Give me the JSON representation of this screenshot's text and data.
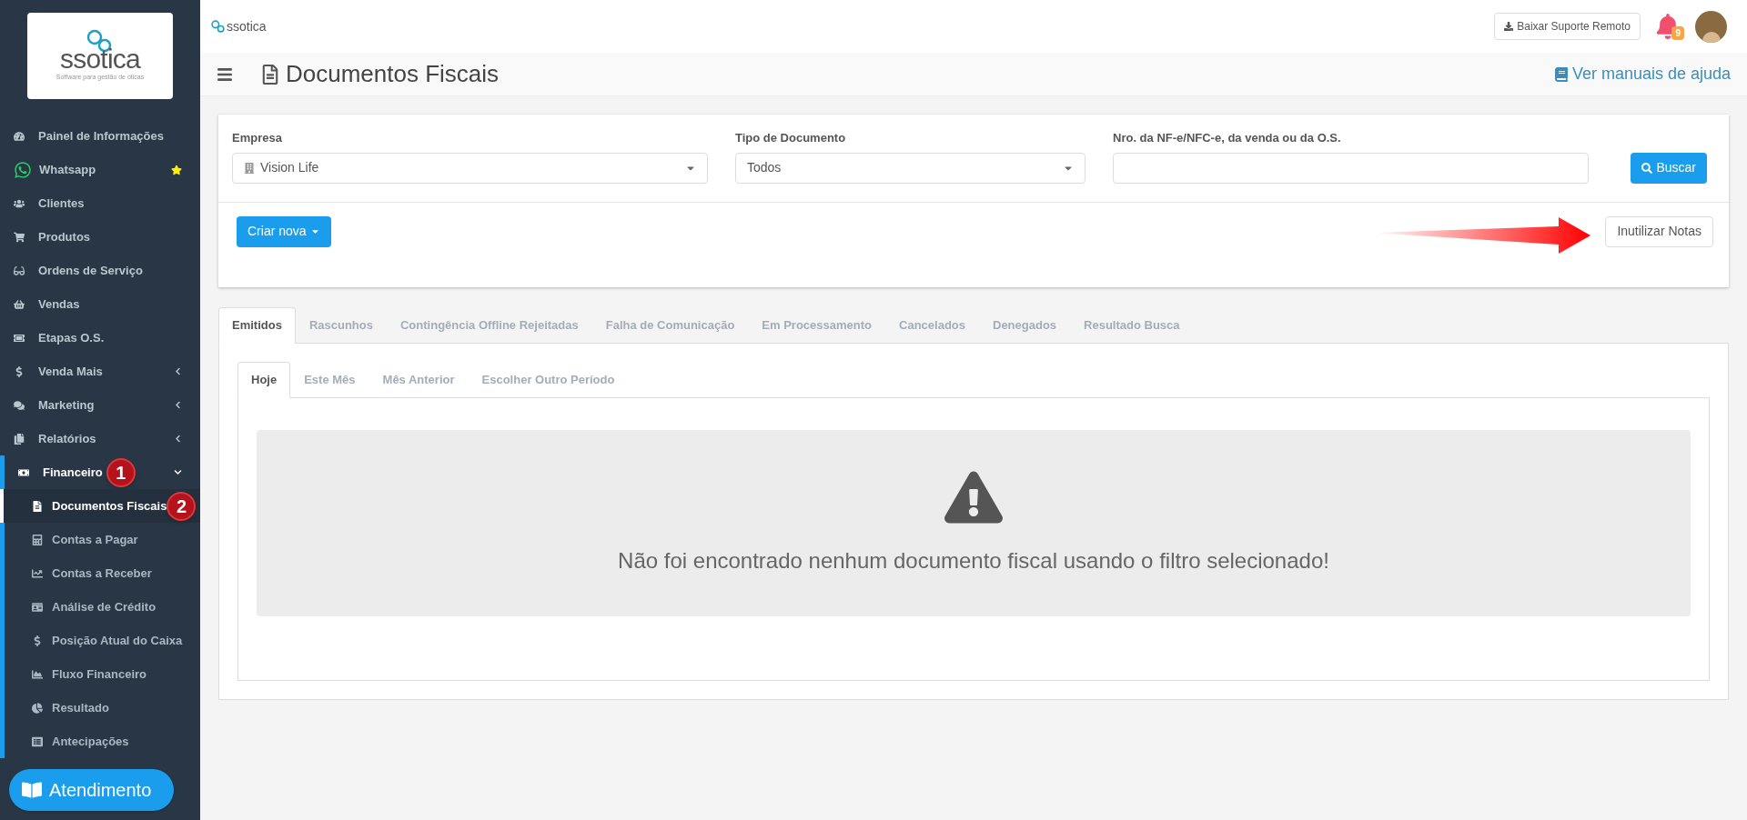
{
  "logo": {
    "name": "ssotica",
    "tagline": "Software para gestão de óticas"
  },
  "sidebar": {
    "items": [
      {
        "kind": "item",
        "label": "Painel de Informações",
        "selected": false
      },
      {
        "kind": "item",
        "label": "Whatsapp",
        "selected": false,
        "starred": true
      },
      {
        "kind": "item",
        "label": "Clientes",
        "selected": false
      },
      {
        "kind": "item",
        "label": "Produtos",
        "selected": false
      },
      {
        "kind": "item",
        "label": "Ordens de Serviço",
        "selected": false
      },
      {
        "kind": "item",
        "label": "Vendas",
        "selected": false
      },
      {
        "kind": "item",
        "label": "Etapas O.S.",
        "selected": false
      },
      {
        "kind": "group",
        "label": "Venda Mais",
        "expanded": false
      },
      {
        "kind": "group",
        "label": "Marketing",
        "expanded": false
      },
      {
        "kind": "group",
        "label": "Relatórios",
        "expanded": false
      },
      {
        "kind": "group",
        "label": "Financeiro",
        "expanded": true,
        "marker": "1",
        "children": [
          {
            "label": "Documentos Fiscais",
            "selected": true,
            "marker": "2"
          },
          {
            "label": "Contas a Pagar",
            "selected": false
          },
          {
            "label": "Contas a Receber",
            "selected": false
          },
          {
            "label": "Análise de Crédito",
            "selected": false
          },
          {
            "label": "Posição Atual do Caixa",
            "selected": false
          },
          {
            "label": "Fluxo Financeiro",
            "selected": false
          },
          {
            "label": "Resultado",
            "selected": false
          },
          {
            "label": "Antecipações",
            "selected": false
          }
        ]
      }
    ]
  },
  "chat_button": "Atendimento",
  "topbar": {
    "logo_text": "ssotica",
    "download_button": "Baixar Suporte Remoto",
    "notification_count": "9"
  },
  "header": {
    "title": "Documentos Fiscais",
    "help_link": "Ver manuais de ajuda"
  },
  "filters": {
    "company": {
      "label": "Empresa",
      "value": "Vision Life"
    },
    "doc_type": {
      "label": "Tipo de Documento",
      "value": "Todos"
    },
    "number": {
      "label": "Nro. da NF-e/NFC-e, da venda ou da O.S."
    },
    "search_button": "Buscar",
    "create_button": "Criar nova",
    "void_button": "Inutilizar Notas"
  },
  "tabs": [
    {
      "label": "Emitidos",
      "selected": true
    },
    {
      "label": "Rascunhos",
      "selected": false
    },
    {
      "label": "Contingência Offline Rejeitadas",
      "selected": false
    },
    {
      "label": "Falha de Comunicação",
      "selected": false
    },
    {
      "label": "Em Processamento",
      "selected": false
    },
    {
      "label": "Cancelados",
      "selected": false
    },
    {
      "label": "Denegados",
      "selected": false
    },
    {
      "label": "Resultado Busca",
      "selected": false
    }
  ],
  "period_tabs": [
    {
      "label": "Hoje",
      "selected": true
    },
    {
      "label": "Este Mês",
      "selected": false
    },
    {
      "label": "Mês Anterior",
      "selected": false
    },
    {
      "label": "Escolher Outro Período",
      "selected": false
    }
  ],
  "empty_message": "Não foi encontrado nenhum documento fiscal usando o filtro selecionado!"
}
